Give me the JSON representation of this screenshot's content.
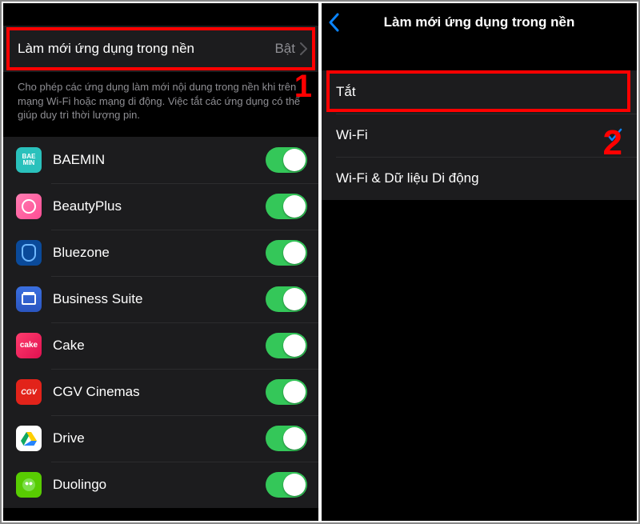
{
  "annotations": {
    "step1": "1",
    "step2": "2"
  },
  "left": {
    "header": {
      "title": "Làm mới ứng dụng trong nền",
      "value": "Bật"
    },
    "description": "Cho phép các ứng dụng làm mới nội dung trong nền khi trên mạng Wi-Fi hoặc mạng di động. Việc tắt các ứng dụng có thể giúp duy trì thời lượng pin.",
    "apps": [
      {
        "name": "BAEMIN",
        "icon": "baemin",
        "enabled": true
      },
      {
        "name": "BeautyPlus",
        "icon": "beautyplus",
        "enabled": true
      },
      {
        "name": "Bluezone",
        "icon": "bluezone",
        "enabled": true
      },
      {
        "name": "Business Suite",
        "icon": "businesssuite",
        "enabled": true
      },
      {
        "name": "Cake",
        "icon": "cake",
        "enabled": true
      },
      {
        "name": "CGV Cinemas",
        "icon": "cgv",
        "enabled": true
      },
      {
        "name": "Drive",
        "icon": "drive",
        "enabled": true
      },
      {
        "name": "Duolingo",
        "icon": "duolingo",
        "enabled": true
      }
    ]
  },
  "right": {
    "title": "Làm mới ứng dụng trong nền",
    "options": [
      {
        "label": "Tắt",
        "selected": false
      },
      {
        "label": "Wi-Fi",
        "selected": true
      },
      {
        "label": "Wi-Fi & Dữ liệu Di động",
        "selected": false
      }
    ]
  }
}
